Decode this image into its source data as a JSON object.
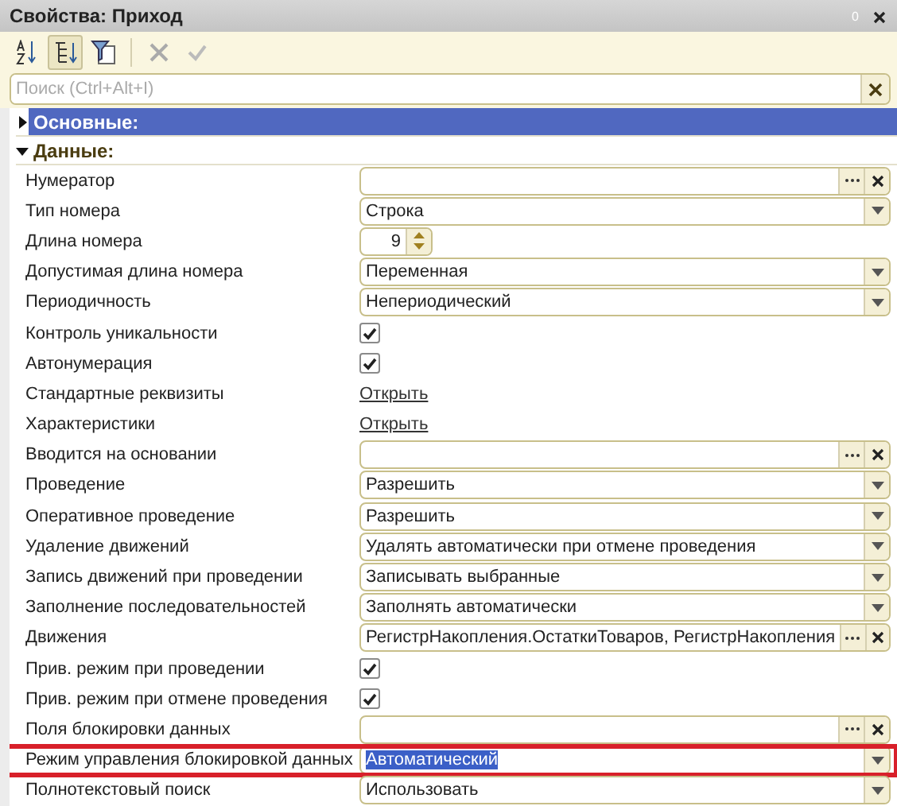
{
  "window": {
    "title": "Свойства: Приход",
    "pin": "0"
  },
  "toolbar": [
    {
      "kind": "sort",
      "pressed": false,
      "disabled": false
    },
    {
      "kind": "tree",
      "pressed": true,
      "disabled": false
    },
    {
      "kind": "filter",
      "pressed": false,
      "disabled": false
    },
    {
      "kind": "cancel",
      "pressed": false,
      "disabled": true
    },
    {
      "kind": "apply",
      "pressed": false,
      "disabled": true
    }
  ],
  "search": {
    "placeholder": "Поиск (Ctrl+Alt+I)"
  },
  "groups": [
    {
      "title": "Основные:",
      "expanded": false,
      "selected": true
    },
    {
      "title": "Данные:",
      "expanded": true,
      "selected": false
    }
  ],
  "rows": [
    {
      "label": "Нумератор",
      "kind": "select",
      "value": "",
      "highlighted": false
    },
    {
      "label": "Тип номера",
      "kind": "choice",
      "value": "Строка",
      "highlighted": false
    },
    {
      "label": "Длина номера",
      "kind": "spin",
      "value": "9",
      "highlighted": false
    },
    {
      "label": "Допустимая длина номера",
      "kind": "choice",
      "value": "Переменная",
      "highlighted": false
    },
    {
      "label": "Периодичность",
      "kind": "choice",
      "value": "Непериодический",
      "highlighted": false
    },
    {
      "label": "Контроль уникальности",
      "kind": "check",
      "checked": true,
      "highlighted": false
    },
    {
      "label": "Автонумерация",
      "kind": "check",
      "checked": true,
      "highlighted": false
    },
    {
      "label": "Стандартные реквизиты",
      "kind": "link",
      "value": "Открыть",
      "highlighted": false
    },
    {
      "label": "Характеристики",
      "kind": "link",
      "value": "Открыть",
      "highlighted": false
    },
    {
      "label": "Вводится на основании",
      "kind": "select",
      "value": "",
      "highlighted": false
    },
    {
      "label": "Проведение",
      "kind": "choice",
      "value": "Разрешить",
      "highlighted": false
    },
    {
      "label": "Оперативное проведение",
      "kind": "choice",
      "value": "Разрешить",
      "highlighted": false
    },
    {
      "label": "Удаление движений",
      "kind": "choice",
      "value": "Удалять автоматически при отмене проведения",
      "highlighted": false
    },
    {
      "label": "Запись движений при проведении",
      "kind": "choice",
      "value": "Записывать выбранные",
      "highlighted": false
    },
    {
      "label": "Заполнение последовательностей",
      "kind": "choice",
      "value": "Заполнять автоматически",
      "highlighted": false
    },
    {
      "label": "Движения",
      "kind": "select",
      "value": "РегистрНакопления.ОстаткиТоваров, РегистрНакопления",
      "highlighted": false
    },
    {
      "label": "Прив. режим при проведении",
      "kind": "check",
      "checked": true,
      "highlighted": false
    },
    {
      "label": "Прив. режим при отмене проведения",
      "kind": "check",
      "checked": true,
      "highlighted": false
    },
    {
      "label": "Поля блокировки данных",
      "kind": "select",
      "value": "",
      "highlighted": false
    },
    {
      "label": "Режим управления блокировкой данных",
      "kind": "choice",
      "value": "Автоматический",
      "highlighted": true
    },
    {
      "label": "Полнотекстовый поиск",
      "kind": "choice",
      "value": "Использовать",
      "highlighted": false
    }
  ]
}
